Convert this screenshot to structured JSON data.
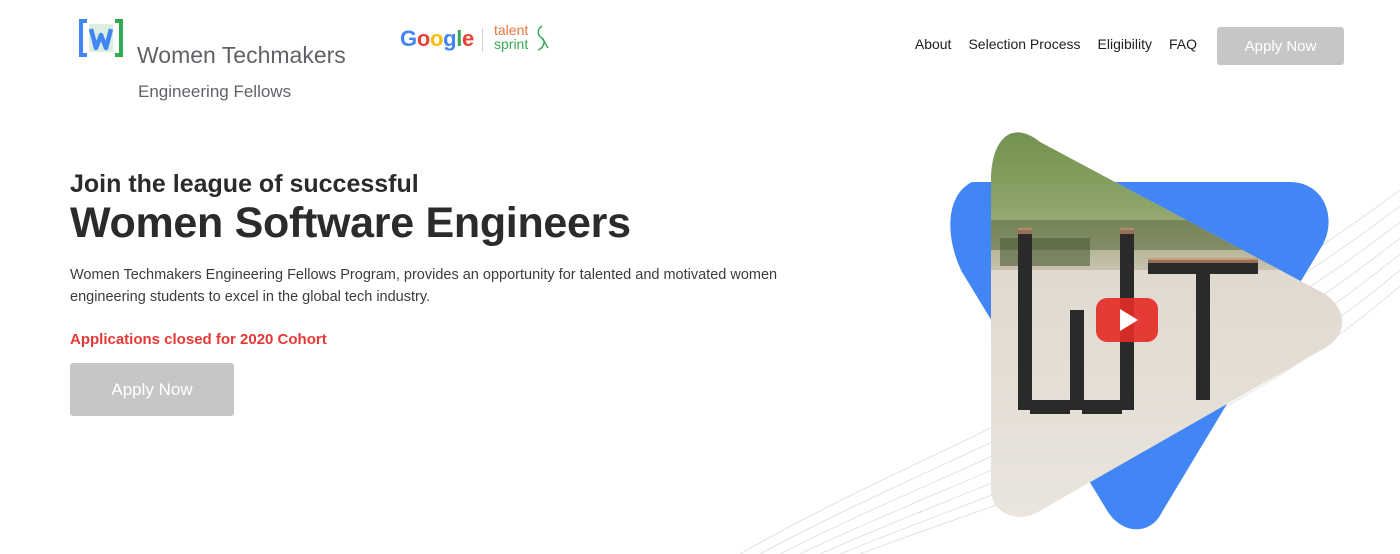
{
  "brand": {
    "title": "Women Techmakers",
    "subtitle": "Engineering Fellows",
    "logo_icon": "women-techmakers-w-logo"
  },
  "partners": {
    "google": "Google",
    "google_colors": [
      "#4285F4",
      "#EA4335",
      "#FBBC05",
      "#4285F4",
      "#34A853",
      "#EA4335"
    ],
    "talentsprint_top": "talent",
    "talentsprint_bottom": "sprint"
  },
  "nav": {
    "items": [
      {
        "label": "About"
      },
      {
        "label": "Selection Process"
      },
      {
        "label": "Eligibility"
      },
      {
        "label": "FAQ"
      }
    ],
    "apply_label": "Apply Now"
  },
  "hero": {
    "lead": "Join the league of successful",
    "title": "Women Software Engineers",
    "description": "Women Techmakers Engineering Fellows Program, provides an opportunity for talented and motivated women engineering students to excel in the global tech industry.",
    "status": "Applications closed for 2020 Cohort",
    "apply_label": "Apply Now"
  },
  "media": {
    "play_icon": "youtube-play-icon",
    "accent_color": "#4285F4"
  },
  "colors": {
    "button_disabled": "#c6c6c6",
    "status_red": "#e53935",
    "text_dark": "#2b2b2b"
  }
}
